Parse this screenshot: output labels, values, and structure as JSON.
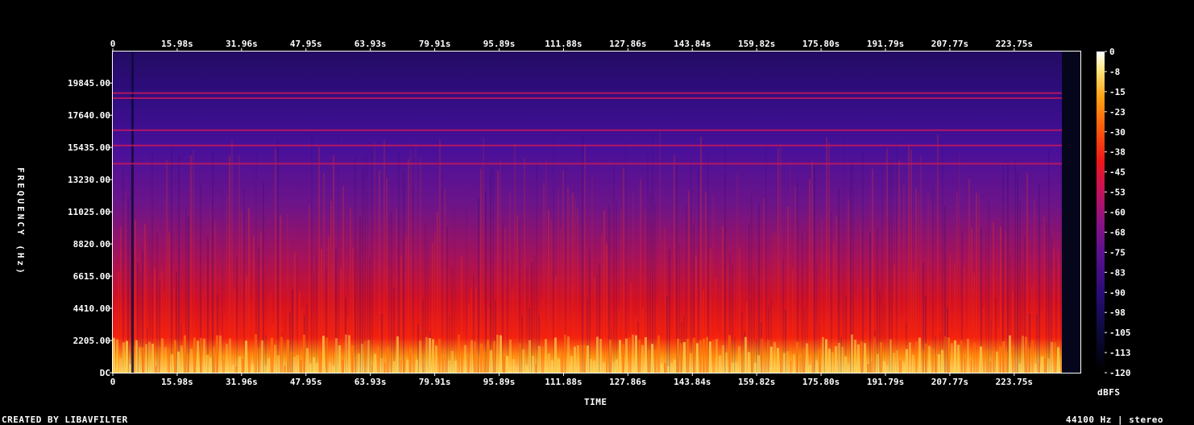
{
  "footer": {
    "created_by": "CREATED BY LIBAVFILTER",
    "sample_info": "44100 Hz | stereo"
  },
  "labels": {
    "time": "TIME",
    "frequency": "FREQUENCY (Hz)",
    "dbfs": "dBFS"
  },
  "colors": {
    "background": "#000000",
    "axis": "#ffffff",
    "palette": [
      "#000000",
      "#08082a",
      "#1e0b5e",
      "#4b0f86",
      "#7a118c",
      "#b5123a",
      "#e61412",
      "#ff5a0a",
      "#ffa214",
      "#ffe66e",
      "#ffffff"
    ]
  },
  "chart_data": {
    "type": "heatmap",
    "title": "",
    "xlabel": "TIME",
    "ylabel": "FREQUENCY (Hz)",
    "x_ticks": [
      "0",
      "15.98s",
      "31.96s",
      "47.95s",
      "63.93s",
      "79.91s",
      "95.89s",
      "111.88s",
      "127.86s",
      "143.84s",
      "159.82s",
      "175.80s",
      "191.79s",
      "207.77s",
      "223.75s"
    ],
    "y_ticks": [
      "DC",
      "2205.00",
      "4410.00",
      "6615.00",
      "8820.00",
      "11025.00",
      "13230.00",
      "15435.00",
      "17640.00",
      "19845.00"
    ],
    "xlim_seconds": [
      0,
      239.7
    ],
    "ylim_hz": [
      0,
      22050
    ],
    "colorbar": {
      "label": "dBFS",
      "ticks": [
        "0",
        "-8",
        "-15",
        "-23",
        "-30",
        "-38",
        "-45",
        "-53",
        "-60",
        "-68",
        "-75",
        "-83",
        "-90",
        "-98",
        "-105",
        "-113",
        "-120"
      ],
      "range_dbfs": [
        -120,
        0
      ]
    },
    "tonal_lines_hz": [
      19200,
      18850,
      16650,
      15600,
      14350
    ],
    "sample_rate_hz": 44100,
    "channels": "stereo"
  }
}
